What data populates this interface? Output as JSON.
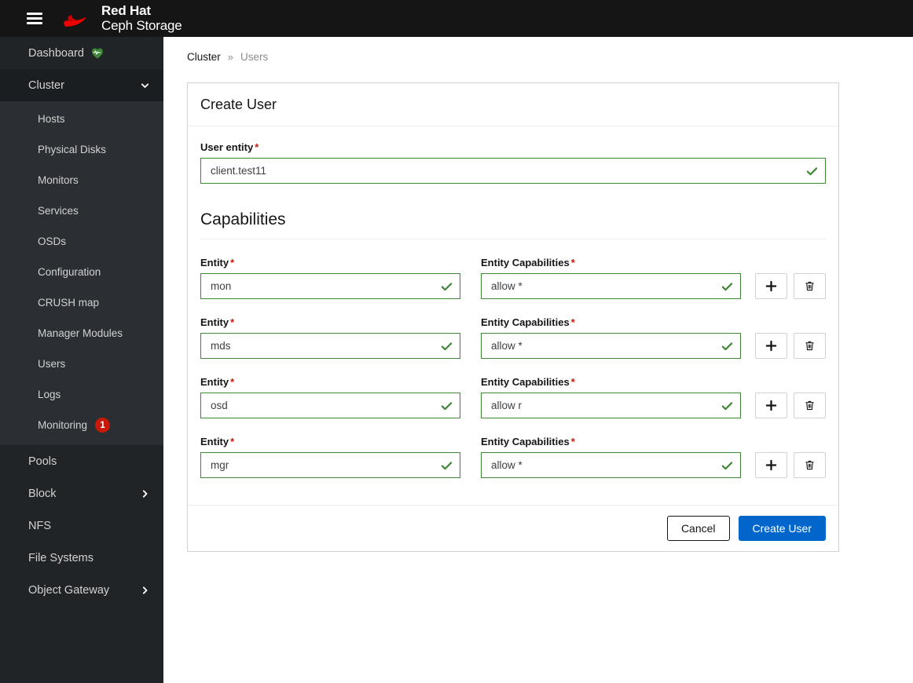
{
  "topbar": {
    "menu_icon": "hamburger-icon",
    "logo_icon": "red-hat-fedora-icon",
    "brand_line1": "Red Hat",
    "brand_line2": "Ceph Storage"
  },
  "sidebar": {
    "dashboard": {
      "label": "Dashboard",
      "status_icon": "heart-pulse-icon"
    },
    "cluster": {
      "label": "Cluster",
      "chevron": "chevron-down-icon",
      "expanded": true
    },
    "cluster_items": [
      {
        "label": "Hosts"
      },
      {
        "label": "Physical Disks"
      },
      {
        "label": "Monitors"
      },
      {
        "label": "Services"
      },
      {
        "label": "OSDs"
      },
      {
        "label": "Configuration"
      },
      {
        "label": "CRUSH map"
      },
      {
        "label": "Manager Modules"
      },
      {
        "label": "Users"
      },
      {
        "label": "Logs"
      },
      {
        "label": "Monitoring",
        "badge": "1"
      }
    ],
    "bottom_items": [
      {
        "label": "Pools",
        "chevron": null
      },
      {
        "label": "Block",
        "chevron": "chevron-right-icon"
      },
      {
        "label": "NFS",
        "chevron": null
      },
      {
        "label": "File Systems",
        "chevron": null
      },
      {
        "label": "Object Gateway",
        "chevron": "chevron-right-icon"
      }
    ]
  },
  "breadcrumb": {
    "parent": "Cluster",
    "separator": "»",
    "current": "Users"
  },
  "card": {
    "title": "Create User",
    "user_entity": {
      "label": "Entity",
      "label_full": "User entity",
      "required_marker": "*",
      "value": "client.test11",
      "placeholder": "",
      "valid_icon": "check-icon"
    },
    "capabilities_section_title": "Capabilities",
    "labels": {
      "entity": "Entity",
      "entity_capabilities": "Entity Capabilities",
      "required_marker": "*"
    },
    "rows": [
      {
        "entity": "mon",
        "capabilities": "allow *",
        "add_icon": "plus-icon",
        "delete_icon": "trash-icon"
      },
      {
        "entity": "mds",
        "capabilities": "allow *",
        "add_icon": "plus-icon",
        "delete_icon": "trash-icon"
      },
      {
        "entity": "osd",
        "capabilities": "allow r",
        "add_icon": "plus-icon",
        "delete_icon": "trash-icon"
      },
      {
        "entity": "mgr",
        "capabilities": "allow *",
        "add_icon": "plus-icon",
        "delete_icon": "trash-icon"
      }
    ],
    "footer": {
      "cancel_label": "Cancel",
      "submit_label": "Create User"
    }
  },
  "colors": {
    "brand_red": "#ee0000",
    "primary_blue": "#0066cc",
    "valid_green": "#3e8635",
    "required_red": "#c9190b",
    "badge_red": "#c9190b",
    "sidebar_bg": "#212427",
    "sidebar_sub_bg": "#2b2f33",
    "topbar_bg": "#151515",
    "edge_blue": "#179ffb"
  }
}
